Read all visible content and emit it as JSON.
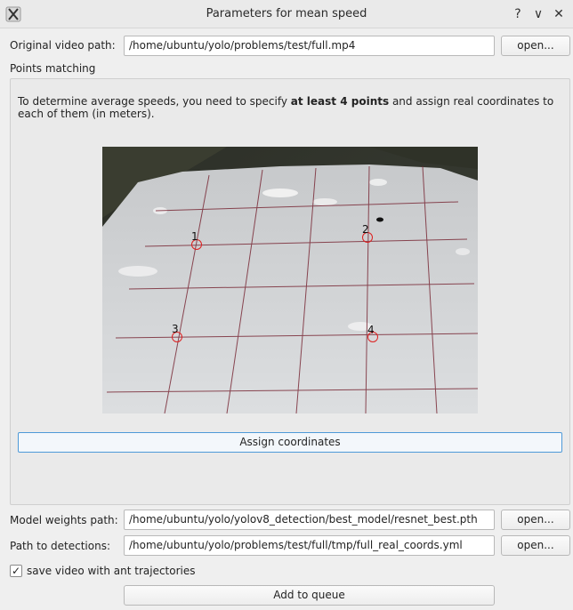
{
  "window": {
    "title": "Parameters for mean speed",
    "help_label": "?",
    "minimize_label": "∨",
    "close_label": "✕"
  },
  "video": {
    "label": "Original video path:",
    "value": "/home/ubuntu/yolo/problems/test/full.mp4",
    "open_label": "open..."
  },
  "points": {
    "group_label": "Points matching",
    "info_pre": "To determine average speeds, you need to specify ",
    "info_bold": "at least 4 points",
    "info_post": " and assign real coordinates to each of them (in meters).",
    "markers": [
      "1",
      "2",
      "3",
      "4"
    ],
    "assign_label": "Assign coordinates"
  },
  "model": {
    "label": "Model weights path:",
    "value": "/home/ubuntu/yolo/yolov8_detection/best_model/resnet_best.pth",
    "open_label": "open..."
  },
  "detections": {
    "label": "Path to detections:",
    "value": "/home/ubuntu/yolo/problems/test/full/tmp/full_real_coords.yml",
    "open_label": "open..."
  },
  "options": {
    "save_video_checked": true,
    "save_video_label": "save video with ant trajectories"
  },
  "footer": {
    "add_label": "Add to queue"
  },
  "colors": {
    "marker": "#dd2020",
    "accent": "#4e9ad8"
  }
}
